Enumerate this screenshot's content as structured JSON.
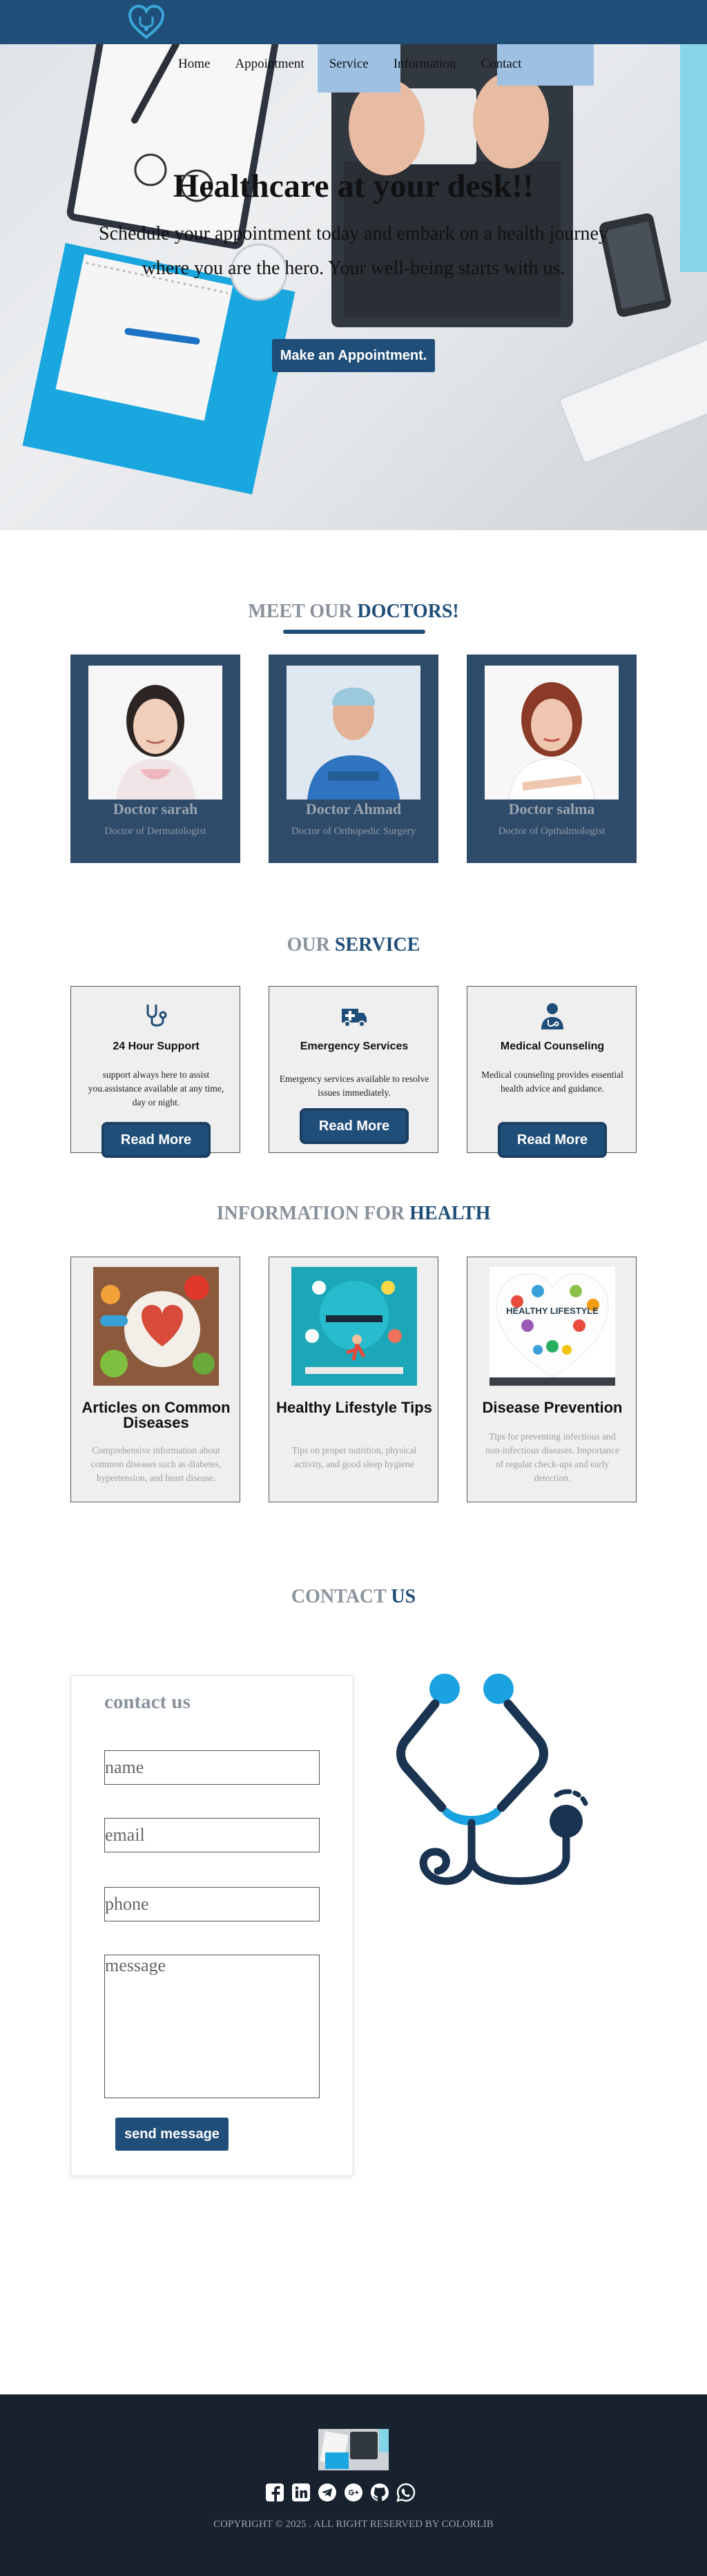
{
  "nav": {
    "logo_icon": "heart-stethoscope-logo",
    "links": [
      "Home",
      "Appointment",
      "Service",
      "Information",
      "Contact"
    ]
  },
  "hero": {
    "title": "Healthcare at your desk!!",
    "subtitle": "Schedule your appointment today and embark on a health journey where you are the hero. Your well-being starts with us.",
    "button": "Make an Appointment."
  },
  "doctors": {
    "title_grey": "MEET OUR",
    "title_blue": "DOCTORS!",
    "items": [
      {
        "name": "Doctor sarah",
        "specialty": "Doctor of Dermatologist"
      },
      {
        "name": "Doctor Ahmad",
        "specialty": "Doctor of Orthopedic Surgery"
      },
      {
        "name": "Doctor salma",
        "specialty": "Doctor of Opthalmologist"
      }
    ]
  },
  "service": {
    "title_grey": "OUR",
    "title_blue": "SERVICE",
    "items": [
      {
        "icon": "stethoscope-icon",
        "title": "24 Hour Support",
        "desc": "support always here to assist you.assistance available at any time, day or night.",
        "button": "Read More"
      },
      {
        "icon": "ambulance-icon",
        "title": "Emergency Services",
        "desc": "Emergency services available to resolve issues immediately.",
        "button": "Read More"
      },
      {
        "icon": "doctor-icon",
        "title": "Medical Counseling",
        "desc": "Medical counseling provides essential health advice and guidance.",
        "button": "Read More"
      }
    ]
  },
  "information": {
    "title_grey": "INFORMATION FOR",
    "title_blue": "HEALTH",
    "items": [
      {
        "title": "Articles on Common Diseases",
        "desc": "Comprehensive information about common diseases such as diabetes, hypertension, and heart disease."
      },
      {
        "title": "Healthy Lifestyle Tips",
        "desc": "Tips on proper nutrition, physical activity, and good sleep hygiene"
      },
      {
        "title": "Disease Prevention",
        "desc": "Tips for preventing infectious and non-infectious diseases. Importance of regular check-ups and early detection."
      }
    ],
    "image_text": "HEALTHY LIFESTYLE"
  },
  "contact": {
    "title_grey": "CONTACT",
    "title_blue": "US",
    "heading": "contact us",
    "placeholders": {
      "name": "name",
      "email": "email",
      "phone": "phone",
      "message": "message"
    },
    "button": "send message"
  },
  "footer": {
    "social_icons": [
      "facebook-icon",
      "linkedin-icon",
      "telegram-icon",
      "google-plus-icon",
      "github-icon",
      "whatsapp-icon"
    ],
    "copyright": "COPYRIGHT © 2025 . ALL RIGHT RESERVED BY COLORLIB"
  },
  "colors": {
    "primary": "#1f4e79",
    "card_dark": "#2e4b6a",
    "footer": "#17222e",
    "accent_cyan": "#1aa3e0"
  }
}
